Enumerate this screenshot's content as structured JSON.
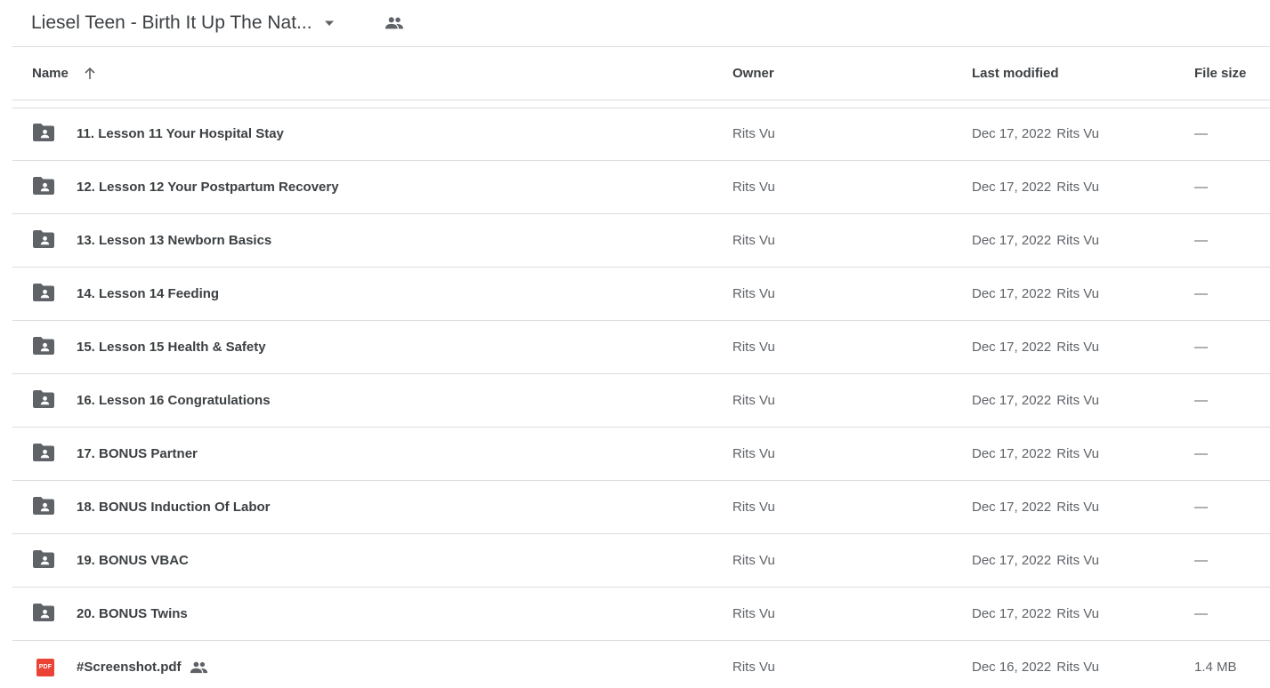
{
  "header": {
    "title": "Liesel Teen - Birth It Up The Nat...",
    "dropdown_icon": "arrow-drop-down-icon",
    "shared_icon": "people-icon"
  },
  "columns": {
    "name": "Name",
    "owner": "Owner",
    "last_modified": "Last modified",
    "file_size": "File size",
    "sort_icon": "arrow-up-icon"
  },
  "rows": [
    {
      "type": "shared-folder",
      "name": "11. Lesson 11 Your Hospital Stay",
      "owner": "Rits Vu",
      "date": "Dec 17, 2022",
      "modified_by": "Rits Vu",
      "size": "—"
    },
    {
      "type": "shared-folder",
      "name": "12. Lesson 12 Your Postpartum Recovery",
      "owner": "Rits Vu",
      "date": "Dec 17, 2022",
      "modified_by": "Rits Vu",
      "size": "—"
    },
    {
      "type": "shared-folder",
      "name": "13. Lesson 13 Newborn Basics",
      "owner": "Rits Vu",
      "date": "Dec 17, 2022",
      "modified_by": "Rits Vu",
      "size": "—"
    },
    {
      "type": "shared-folder",
      "name": "14. Lesson 14 Feeding",
      "owner": "Rits Vu",
      "date": "Dec 17, 2022",
      "modified_by": "Rits Vu",
      "size": "—"
    },
    {
      "type": "shared-folder",
      "name": "15. Lesson 15 Health & Safety",
      "owner": "Rits Vu",
      "date": "Dec 17, 2022",
      "modified_by": "Rits Vu",
      "size": "—"
    },
    {
      "type": "shared-folder",
      "name": "16. Lesson 16 Congratulations",
      "owner": "Rits Vu",
      "date": "Dec 17, 2022",
      "modified_by": "Rits Vu",
      "size": "—"
    },
    {
      "type": "shared-folder",
      "name": "17. BONUS Partner",
      "owner": "Rits Vu",
      "date": "Dec 17, 2022",
      "modified_by": "Rits Vu",
      "size": "—"
    },
    {
      "type": "shared-folder",
      "name": "18. BONUS Induction Of Labor",
      "owner": "Rits Vu",
      "date": "Dec 17, 2022",
      "modified_by": "Rits Vu",
      "size": "—"
    },
    {
      "type": "shared-folder",
      "name": "19. BONUS VBAC",
      "owner": "Rits Vu",
      "date": "Dec 17, 2022",
      "modified_by": "Rits Vu",
      "size": "—"
    },
    {
      "type": "shared-folder",
      "name": "20. BONUS Twins",
      "owner": "Rits Vu",
      "date": "Dec 17, 2022",
      "modified_by": "Rits Vu",
      "size": "—"
    },
    {
      "type": "pdf",
      "name": "#Screenshot.pdf",
      "shared": true,
      "owner": "Rits Vu",
      "date": "Dec 16, 2022",
      "modified_by": "Rits Vu",
      "size": "1.4 MB",
      "icon_label": "PDF"
    }
  ],
  "colors": {
    "pdf": "#ea4335",
    "folder_icon": "#5f6368",
    "divider": "#dadce0"
  }
}
